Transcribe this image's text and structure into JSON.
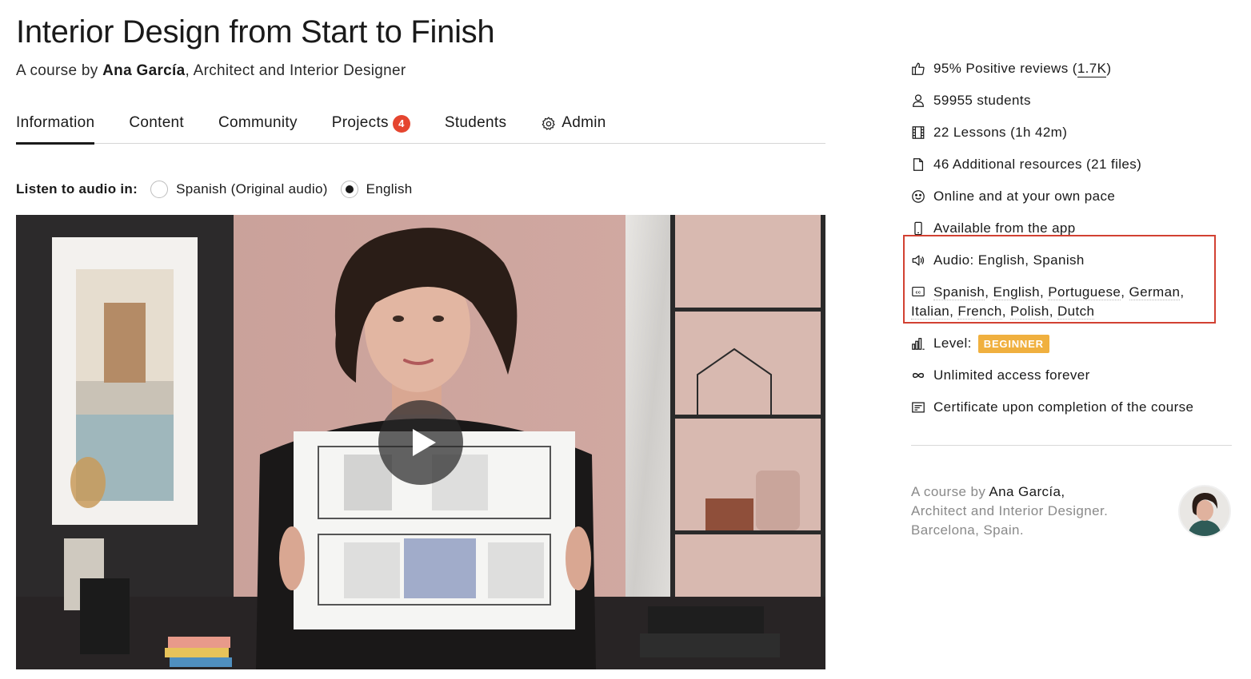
{
  "header": {
    "title": "Interior Design from Start to Finish",
    "subtitle_prefix": "A course by ",
    "author_name": "Ana García",
    "subtitle_suffix": ", Architect and Interior Designer"
  },
  "tabs": [
    {
      "label": "Information",
      "active": true
    },
    {
      "label": "Content"
    },
    {
      "label": "Community"
    },
    {
      "label": "Projects",
      "badge": "4"
    },
    {
      "label": "Students"
    },
    {
      "label": "Admin",
      "icon": "gear-icon"
    }
  ],
  "audio": {
    "label": "Listen to audio in:",
    "options": [
      {
        "label": "Spanish (Original audio)",
        "selected": false
      },
      {
        "label": "English",
        "selected": true
      }
    ]
  },
  "video": {
    "play_icon": "play-icon"
  },
  "sidebar": {
    "reviews_text": "95% Positive reviews (",
    "reviews_count": "1.7K",
    "reviews_close": ")",
    "students": "59955 students",
    "lessons": "22 Lessons (1h 42m)",
    "resources": "46 Additional resources (21 files)",
    "pace": "Online and at your own pace",
    "app": "Available from the app",
    "audio_langs": "Audio: English, Spanish",
    "subtitles": [
      "Spanish",
      "English",
      "Portuguese",
      "German",
      "Italian",
      "French",
      "Polish",
      "Dutch"
    ],
    "level_label": "Level:",
    "level_value": "BEGINNER",
    "access": "Unlimited access forever",
    "certificate": "Certificate upon completion of the course"
  },
  "author_card": {
    "prefix": "A course by ",
    "name": "Ana García,",
    "line2": "Architect and Interior Designer.",
    "line3": "Barcelona, Spain."
  },
  "colors": {
    "badge_red": "#e5452f",
    "level_orange": "#f0b03f",
    "highlight_red": "#d24132"
  }
}
